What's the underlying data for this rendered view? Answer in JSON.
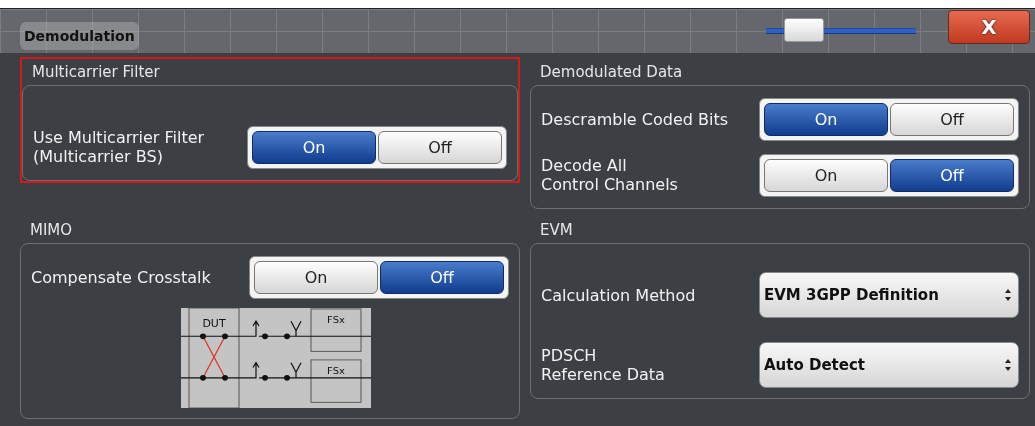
{
  "window": {
    "title": "Demodulation",
    "transparency_slider": {
      "level": 0.12
    },
    "close_label": "X"
  },
  "sections": [
    {
      "title": "Multicarrier Filter",
      "highlighted": true,
      "rows": [
        {
          "kind": "toggle",
          "label_lines": [
            "Use Multicarrier Filter",
            "(Multicarrier BS)"
          ],
          "options": [
            {
              "label": "On",
              "selected": true
            },
            {
              "label": "Off",
              "selected": false
            }
          ]
        }
      ]
    },
    {
      "title": "Demodulated Data",
      "highlighted": false,
      "rows": [
        {
          "kind": "toggle",
          "label_lines": [
            "Descramble Coded Bits"
          ],
          "options": [
            {
              "label": "On",
              "selected": true
            },
            {
              "label": "Off",
              "selected": false
            }
          ]
        },
        {
          "kind": "toggle",
          "label_lines": [
            "Decode All",
            "Control Channels"
          ],
          "options": [
            {
              "label": "On",
              "selected": false
            },
            {
              "label": "Off",
              "selected": true
            }
          ]
        }
      ]
    },
    {
      "title": "MIMO",
      "highlighted": false,
      "rows": [
        {
          "kind": "toggle",
          "label_lines": [
            "Compensate Crosstalk"
          ],
          "options": [
            {
              "label": "On",
              "selected": false
            },
            {
              "label": "Off",
              "selected": true
            }
          ]
        },
        {
          "kind": "diagram",
          "labels": [
            "DUT",
            "FSx",
            "FSx"
          ]
        }
      ]
    },
    {
      "title": "EVM",
      "highlighted": false,
      "rows": [
        {
          "kind": "select",
          "label_lines": [
            "Calculation Method"
          ],
          "value": "EVM 3GPP Definition"
        },
        {
          "kind": "select",
          "label_lines": [
            "PDSCH",
            "Reference Data"
          ],
          "value": "Auto Detect"
        }
      ]
    }
  ]
}
